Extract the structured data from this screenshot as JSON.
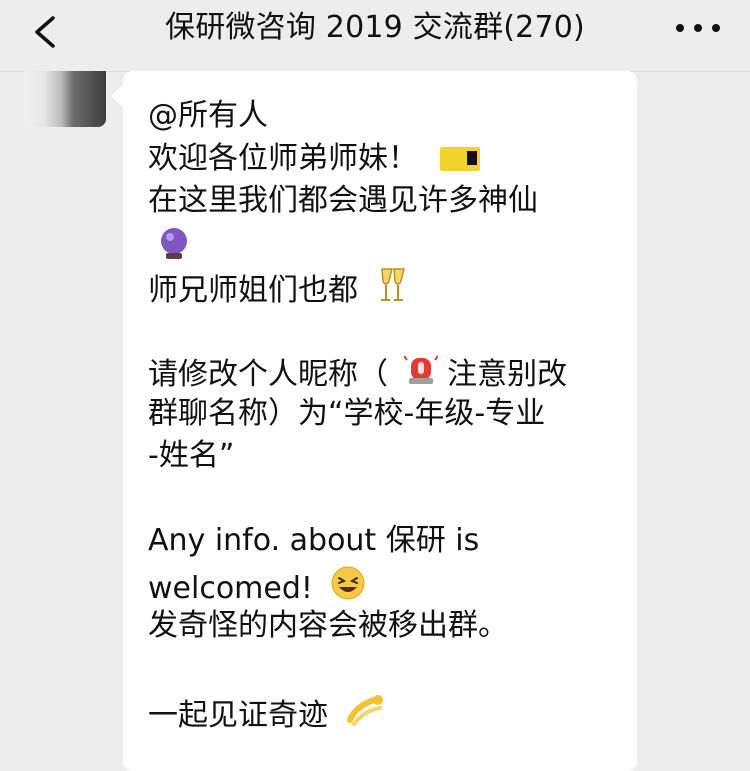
{
  "header": {
    "back_label": "<",
    "title": "保研微咨询 2019 交流群(270)",
    "more_label": "•••"
  },
  "message": {
    "lines": [
      "@所有人",
      "欢迎各位师弟师妹！",
      "在这里我们都会遇见许多神仙",
      "",
      "师兄师姐们也都",
      "",
      "请修改个人昵称（",
      "群聊名称）为“学校-年级-专业",
      "-姓名”",
      "",
      "Any info. about 保研 is",
      "welcomed!",
      "发奇怪的内容会被移出群。",
      "",
      "一起见证奇迹"
    ],
    "segment_after_alarm": "注意别改"
  },
  "icons": {
    "ticket": "ticket-icon",
    "crystal_ball": "crystal-ball-icon",
    "champagne": "champagne-icon",
    "alarm": "police-light-icon",
    "laugh": "laughing-face-icon",
    "dizzy": "dizzy-icon"
  },
  "colors": {
    "background": "#ededed",
    "bubble": "#ffffff",
    "text": "#111111",
    "ticket": "#f2d32a",
    "alarm": "#e53935",
    "crystal": "#7e57c2",
    "laugh": "#f7c948",
    "dizzy": "#f4c12f"
  }
}
